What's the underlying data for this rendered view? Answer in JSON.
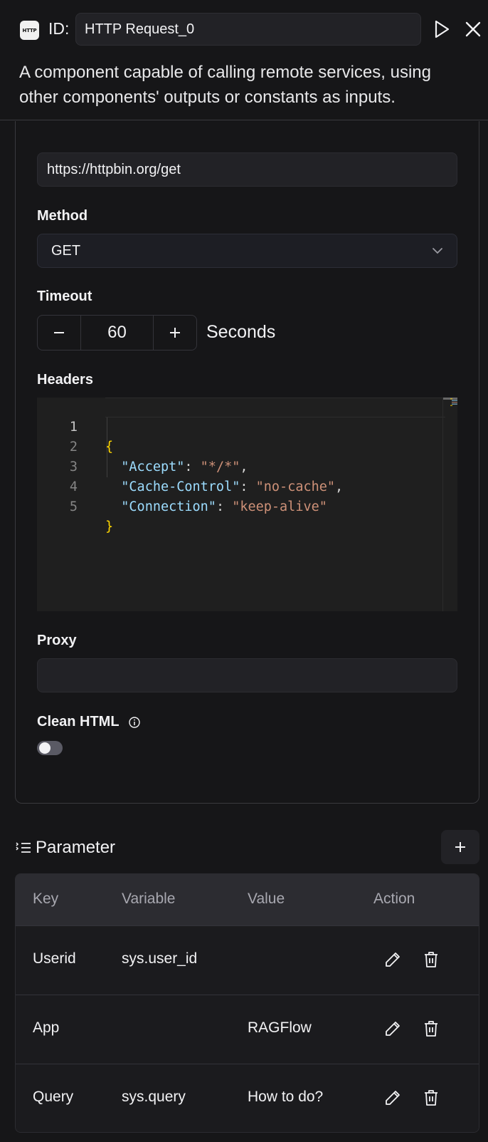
{
  "header": {
    "logo_text": "HTTP",
    "id_label": "ID:",
    "id_value": "HTTP Request_0",
    "description": "A component capable of calling remote services, using other components' outputs or constants as inputs."
  },
  "form": {
    "url_value": "https://httpbin.org/get",
    "method_label": "Method",
    "method_value": "GET",
    "timeout_label": "Timeout",
    "timeout_value": "60",
    "timeout_unit": "Seconds",
    "headers_label": "Headers",
    "headers_code": {
      "line_numbers": [
        "1",
        "2",
        "3",
        "4",
        "5"
      ],
      "open_brace": "{",
      "entries": [
        {
          "key": "\"Accept\"",
          "value": "\"*/*\"",
          "trail": ","
        },
        {
          "key": "\"Cache-Control\"",
          "value": "\"no-cache\"",
          "trail": ","
        },
        {
          "key": "\"Connection\"",
          "value": "\"keep-alive\"",
          "trail": ""
        }
      ],
      "colon": ": ",
      "close_brace": "}"
    },
    "proxy_label": "Proxy",
    "proxy_value": "",
    "clean_html_label": "Clean HTML",
    "clean_html_enabled": false
  },
  "parameter": {
    "title": "Parameter",
    "columns": [
      "Key",
      "Variable",
      "Value",
      "Action"
    ],
    "rows": [
      {
        "key": "Userid",
        "variable": "sys.user_id",
        "value": ""
      },
      {
        "key": "App",
        "variable": "",
        "value": "RAGFlow"
      },
      {
        "key": "Query",
        "variable": "sys.query",
        "value": "How to do?"
      }
    ]
  },
  "icons": {
    "logo": "http-logo-icon",
    "run": "play-icon",
    "close": "close-icon",
    "method_dropdown": "chevron-down-icon",
    "decrement": "minus-icon",
    "increment": "plus-icon",
    "info": "info-icon",
    "parameter": "list-icon",
    "add": "plus-icon",
    "edit": "pencil-icon",
    "delete": "trash-icon"
  }
}
